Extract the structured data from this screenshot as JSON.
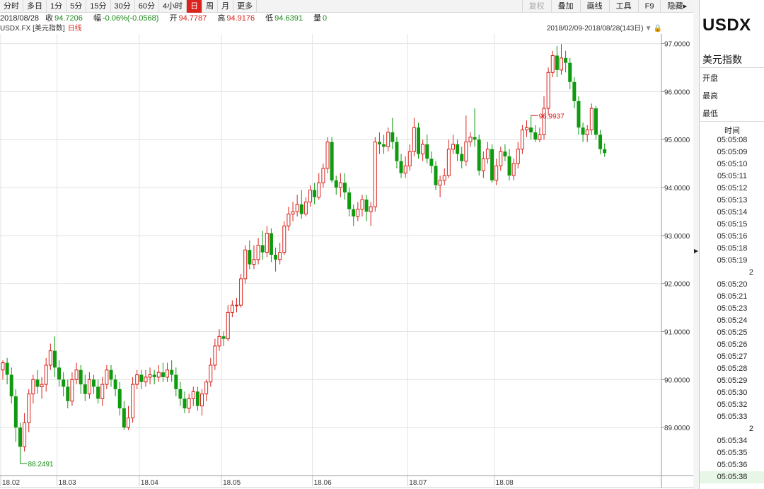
{
  "toolbar": {
    "periods": [
      "分时",
      "多日",
      "1分",
      "5分",
      "15分",
      "30分",
      "60分",
      "4小时",
      "日",
      "周",
      "月",
      "更多"
    ],
    "active_period": "日",
    "right_buttons": [
      "复权",
      "叠加",
      "画线",
      "工具",
      "F9",
      "隐藏▸"
    ]
  },
  "quote": {
    "date": "2018/08/28",
    "close_label": "收",
    "close": "94.7206",
    "change_label": "幅",
    "change": "-0.06%(-0.0568)",
    "open_label": "开",
    "open": "94.7787",
    "high_label": "高",
    "high": "94.9176",
    "low_label": "低",
    "low": "94.6391",
    "volume_label": "量",
    "volume": "0"
  },
  "chart_header": {
    "symbol_text": "USDX.FX [美元指数]",
    "kline_text": "日线",
    "range_text": "2018/02/09-2018/08/28(143日)"
  },
  "colors": {
    "up": "#d9231c",
    "down": "#0f9a0f",
    "grid": "#e3e3e3",
    "axis": "#999999"
  },
  "chart_data": {
    "type": "candlestick",
    "title": "",
    "period": "日线",
    "ylim": [
      88.0,
      97.2
    ],
    "y_ticks": [
      "97.0000",
      "96.0000",
      "95.0000",
      "94.0000",
      "93.0000",
      "92.0000",
      "91.0000",
      "90.0000",
      "89.0000"
    ],
    "x_tick_labels": [
      "18.02",
      "18.03",
      "18.04",
      "18.05",
      "18.06",
      "18.07",
      "18.08"
    ],
    "x_tick_index": [
      0,
      13,
      32,
      51,
      72,
      94,
      114
    ],
    "max_label": "96.9937",
    "max_index": 122,
    "min_label": "88.2491",
    "min_index": 4,
    "grid": true,
    "candles": [
      [
        90.2,
        90.35,
        90.0,
        90.4
      ],
      [
        90.35,
        90.1,
        89.9,
        90.45
      ],
      [
        90.1,
        89.65,
        89.5,
        90.25
      ],
      [
        89.65,
        89.0,
        88.7,
        89.8
      ],
      [
        89.0,
        88.6,
        88.25,
        89.1
      ],
      [
        88.6,
        89.1,
        88.5,
        89.3
      ],
      [
        89.1,
        89.7,
        88.9,
        89.8
      ],
      [
        89.7,
        90.0,
        89.5,
        90.1
      ],
      [
        90.0,
        89.85,
        89.7,
        90.2
      ],
      [
        89.85,
        89.9,
        89.6,
        90.05
      ],
      [
        89.9,
        90.3,
        89.75,
        90.45
      ],
      [
        90.3,
        90.6,
        90.2,
        90.75
      ],
      [
        90.6,
        90.25,
        90.05,
        90.9
      ],
      [
        90.25,
        90.0,
        89.85,
        90.4
      ],
      [
        90.0,
        89.85,
        89.65,
        90.15
      ],
      [
        89.85,
        89.55,
        89.4,
        90.0
      ],
      [
        89.55,
        90.0,
        89.45,
        90.15
      ],
      [
        90.0,
        90.2,
        89.9,
        90.35
      ],
      [
        90.2,
        89.9,
        89.7,
        90.3
      ],
      [
        89.9,
        89.7,
        89.55,
        90.1
      ],
      [
        89.7,
        90.0,
        89.6,
        90.15
      ],
      [
        90.0,
        89.85,
        89.7,
        90.1
      ],
      [
        89.85,
        89.6,
        89.5,
        90.0
      ],
      [
        89.6,
        89.9,
        89.45,
        90.05
      ],
      [
        89.9,
        90.2,
        89.8,
        90.3
      ],
      [
        90.2,
        90.0,
        89.85,
        90.3
      ],
      [
        90.0,
        89.8,
        89.65,
        90.1
      ],
      [
        89.8,
        89.4,
        89.25,
        89.95
      ],
      [
        89.4,
        89.0,
        88.95,
        89.55
      ],
      [
        89.0,
        89.2,
        88.95,
        89.45
      ],
      [
        89.2,
        89.9,
        89.1,
        90.05
      ],
      [
        89.9,
        90.1,
        89.8,
        90.2
      ],
      [
        90.1,
        89.95,
        89.8,
        90.2
      ],
      [
        89.95,
        90.05,
        89.85,
        90.2
      ],
      [
        90.05,
        90.1,
        89.9,
        90.25
      ],
      [
        90.1,
        90.05,
        89.9,
        90.2
      ],
      [
        90.05,
        90.15,
        89.95,
        90.3
      ],
      [
        90.15,
        90.05,
        89.95,
        90.35
      ],
      [
        90.05,
        90.2,
        89.95,
        90.35
      ],
      [
        90.2,
        90.1,
        89.95,
        90.4
      ],
      [
        90.1,
        89.8,
        89.65,
        90.25
      ],
      [
        89.8,
        89.6,
        89.45,
        89.95
      ],
      [
        89.6,
        89.4,
        89.3,
        89.75
      ],
      [
        89.4,
        89.6,
        89.3,
        89.7
      ],
      [
        89.6,
        89.75,
        89.45,
        89.85
      ],
      [
        89.75,
        89.45,
        89.35,
        89.85
      ],
      [
        89.45,
        89.7,
        89.25,
        89.8
      ],
      [
        89.7,
        89.95,
        89.55,
        90.0
      ],
      [
        89.95,
        90.3,
        89.85,
        90.45
      ],
      [
        90.3,
        90.7,
        90.2,
        90.85
      ],
      [
        90.7,
        90.9,
        90.6,
        91.05
      ],
      [
        90.9,
        90.85,
        90.7,
        91.0
      ],
      [
        90.85,
        91.4,
        90.8,
        91.55
      ],
      [
        91.4,
        91.55,
        91.3,
        91.65
      ],
      [
        91.55,
        91.55,
        91.4,
        91.7
      ],
      [
        91.55,
        92.1,
        91.5,
        92.2
      ],
      [
        92.1,
        92.7,
        92.0,
        92.8
      ],
      [
        92.7,
        92.4,
        92.3,
        92.9
      ],
      [
        92.4,
        92.5,
        92.3,
        92.8
      ],
      [
        92.5,
        92.8,
        92.4,
        92.95
      ],
      [
        92.8,
        92.65,
        92.5,
        93.1
      ],
      [
        92.65,
        93.05,
        92.55,
        93.2
      ],
      [
        93.05,
        92.6,
        92.45,
        93.15
      ],
      [
        92.6,
        92.5,
        92.25,
        92.75
      ],
      [
        92.5,
        92.65,
        92.4,
        92.85
      ],
      [
        92.65,
        93.2,
        92.6,
        93.3
      ],
      [
        93.2,
        93.45,
        93.1,
        93.6
      ],
      [
        93.45,
        93.5,
        93.3,
        93.7
      ],
      [
        93.5,
        93.65,
        93.4,
        93.85
      ],
      [
        93.65,
        93.45,
        93.35,
        93.95
      ],
      [
        93.45,
        93.7,
        93.4,
        93.8
      ],
      [
        93.7,
        93.95,
        93.6,
        94.05
      ],
      [
        93.95,
        93.8,
        93.65,
        94.1
      ],
      [
        93.8,
        94.1,
        93.75,
        94.3
      ],
      [
        94.1,
        94.4,
        94.0,
        94.5
      ],
      [
        94.4,
        94.95,
        94.3,
        95.05
      ],
      [
        94.95,
        94.15,
        94.1,
        95.05
      ],
      [
        94.15,
        94.0,
        93.85,
        94.25
      ],
      [
        94.0,
        94.1,
        93.8,
        94.3
      ],
      [
        94.1,
        93.9,
        93.75,
        94.3
      ],
      [
        93.9,
        93.55,
        93.4,
        94.0
      ],
      [
        93.55,
        93.4,
        93.2,
        93.65
      ],
      [
        93.4,
        93.55,
        93.3,
        93.7
      ],
      [
        93.55,
        93.75,
        93.4,
        93.85
      ],
      [
        93.75,
        93.5,
        93.3,
        93.85
      ],
      [
        93.5,
        93.6,
        93.2,
        93.7
      ],
      [
        93.6,
        94.95,
        93.5,
        95.05
      ],
      [
        94.95,
        94.9,
        94.7,
        95.15
      ],
      [
        94.9,
        94.85,
        94.7,
        95.1
      ],
      [
        94.85,
        95.15,
        94.75,
        95.25
      ],
      [
        95.15,
        94.95,
        94.8,
        95.45
      ],
      [
        94.95,
        94.55,
        94.4,
        95.05
      ],
      [
        94.55,
        94.3,
        94.2,
        94.7
      ],
      [
        94.3,
        94.45,
        94.2,
        94.65
      ],
      [
        94.45,
        94.75,
        94.35,
        94.9
      ],
      [
        94.75,
        95.25,
        94.65,
        95.45
      ],
      [
        95.25,
        94.7,
        94.6,
        95.35
      ],
      [
        94.7,
        94.9,
        94.55,
        95.0
      ],
      [
        94.9,
        94.6,
        94.5,
        95.1
      ],
      [
        94.6,
        94.45,
        94.3,
        94.75
      ],
      [
        94.45,
        94.05,
        93.95,
        94.55
      ],
      [
        94.05,
        94.15,
        93.8,
        94.25
      ],
      [
        94.15,
        94.25,
        94.05,
        94.4
      ],
      [
        94.25,
        94.8,
        94.2,
        95.0
      ],
      [
        94.8,
        94.9,
        94.7,
        95.1
      ],
      [
        94.9,
        94.7,
        94.55,
        95.0
      ],
      [
        94.7,
        94.55,
        94.4,
        94.85
      ],
      [
        94.55,
        94.95,
        94.45,
        95.5
      ],
      [
        94.95,
        95.05,
        94.85,
        95.15
      ],
      [
        95.05,
        95.0,
        94.85,
        95.65
      ],
      [
        95.0,
        94.35,
        94.25,
        95.1
      ],
      [
        94.35,
        94.6,
        94.2,
        94.75
      ],
      [
        94.6,
        94.8,
        94.5,
        94.95
      ],
      [
        94.8,
        94.15,
        94.1,
        94.9
      ],
      [
        94.15,
        94.45,
        94.05,
        94.6
      ],
      [
        94.45,
        94.75,
        94.35,
        94.85
      ],
      [
        94.75,
        94.65,
        94.55,
        94.9
      ],
      [
        94.65,
        94.25,
        94.15,
        94.8
      ],
      [
        94.25,
        94.5,
        94.15,
        94.6
      ],
      [
        94.5,
        94.8,
        94.4,
        94.95
      ],
      [
        94.8,
        95.2,
        94.7,
        95.3
      ],
      [
        95.2,
        95.25,
        95.05,
        95.4
      ],
      [
        95.25,
        95.15,
        95.0,
        95.5
      ],
      [
        95.15,
        95.0,
        94.95,
        95.3
      ],
      [
        95.0,
        95.1,
        94.95,
        95.25
      ],
      [
        95.1,
        95.65,
        95.0,
        95.9
      ],
      [
        95.65,
        96.4,
        95.5,
        96.5
      ],
      [
        96.4,
        96.75,
        96.3,
        96.85
      ],
      [
        96.75,
        96.45,
        96.3,
        96.95
      ],
      [
        96.45,
        96.7,
        96.35,
        96.99
      ],
      [
        96.7,
        96.6,
        96.4,
        96.85
      ],
      [
        96.6,
        96.2,
        96.05,
        96.7
      ],
      [
        96.2,
        95.8,
        95.65,
        96.3
      ],
      [
        95.8,
        95.25,
        95.1,
        95.9
      ],
      [
        95.25,
        95.1,
        94.95,
        95.35
      ],
      [
        95.1,
        95.2,
        94.95,
        95.3
      ],
      [
        95.2,
        95.65,
        95.1,
        95.75
      ],
      [
        95.65,
        95.1,
        95.0,
        95.7
      ],
      [
        95.1,
        94.8,
        94.7,
        95.2
      ],
      [
        94.8,
        94.72,
        94.64,
        94.92
      ]
    ]
  },
  "sidebar": {
    "symbol": "USDX",
    "name": "美元指数",
    "fields": [
      "开盘",
      "最高",
      "最低"
    ],
    "ticks_header": "时间",
    "ticks": [
      "05:05:08",
      "05:05:09",
      "05:05:10",
      "05:05:11",
      "05:05:12",
      "05:05:13",
      "05:05:14",
      "05:05:15",
      "05:05:16",
      "05:05:18",
      "05:05:19",
      "2",
      "05:05:20",
      "05:05:21",
      "05:05:23",
      "05:05:24",
      "05:05:25",
      "05:05:26",
      "05:05:27",
      "05:05:28",
      "05:05:29",
      "05:05:30",
      "05:05:32",
      "05:05:33",
      "2",
      "05:05:34",
      "05:05:35",
      "05:05:36",
      "05:05:38"
    ]
  }
}
